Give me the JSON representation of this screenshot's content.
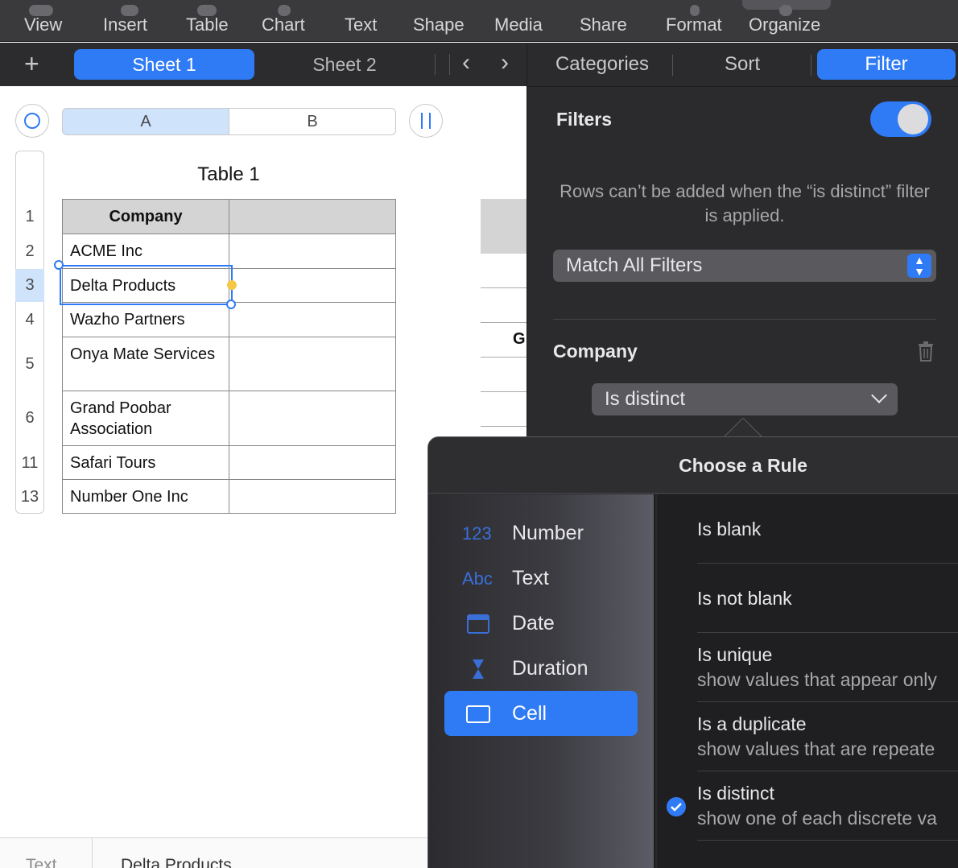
{
  "toolbar": {
    "items": [
      "View",
      "Insert",
      "Table",
      "Chart",
      "Text",
      "Shape",
      "Media",
      "Share",
      "Format",
      "Organize"
    ]
  },
  "sheets": {
    "tabs": [
      "Sheet 1",
      "Sheet 2"
    ],
    "add_label": "+",
    "prev_label": "‹",
    "next_label": "›"
  },
  "spreadsheet": {
    "columns": [
      "A",
      "B"
    ],
    "table_title": "Table 1",
    "header": "Company",
    "row_numbers": [
      "1",
      "2",
      "3",
      "4",
      "5",
      "6",
      "11",
      "13"
    ],
    "rows": [
      [
        "ACME Inc",
        ""
      ],
      [
        "Delta Products",
        ""
      ],
      [
        "Wazho Partners",
        ""
      ],
      [
        "Onya Mate Services",
        ""
      ],
      [
        "Grand Poobar Association",
        ""
      ],
      [
        "Safari Tours",
        ""
      ],
      [
        "Number One Inc",
        ""
      ]
    ],
    "second_table_letter": "G"
  },
  "bottom_bar": {
    "label": "Text",
    "value": "Delta Products"
  },
  "panel": {
    "tabs": [
      "Categories",
      "Sort",
      "Filter"
    ],
    "filters_title": "Filters",
    "note": "Rows can’t be added when the “is distinct” filter is applied.",
    "match_select": "Match All Filters",
    "company_label": "Company",
    "rule_select": "Is distinct"
  },
  "popover": {
    "title": "Choose a Rule",
    "categories": [
      {
        "icon": "123",
        "label": "Number"
      },
      {
        "icon": "Abc",
        "label": "Text"
      },
      {
        "icon": "calendar-icon",
        "label": "Date"
      },
      {
        "icon": "hourglass-icon",
        "label": "Duration"
      },
      {
        "icon": "cell-icon",
        "label": "Cell"
      }
    ],
    "rules": [
      {
        "title": "Is blank",
        "subtitle": ""
      },
      {
        "title": "Is not blank",
        "subtitle": ""
      },
      {
        "title": "Is unique",
        "subtitle": "show values that appear only"
      },
      {
        "title": "Is a duplicate",
        "subtitle": "show values that are repeate"
      },
      {
        "title": "Is distinct",
        "subtitle": "show one of each discrete va"
      }
    ]
  },
  "colors": {
    "accent": "#2f7af5",
    "panel_bg": "#2b2b2d",
    "selection_fill": "#cfe3fb"
  }
}
